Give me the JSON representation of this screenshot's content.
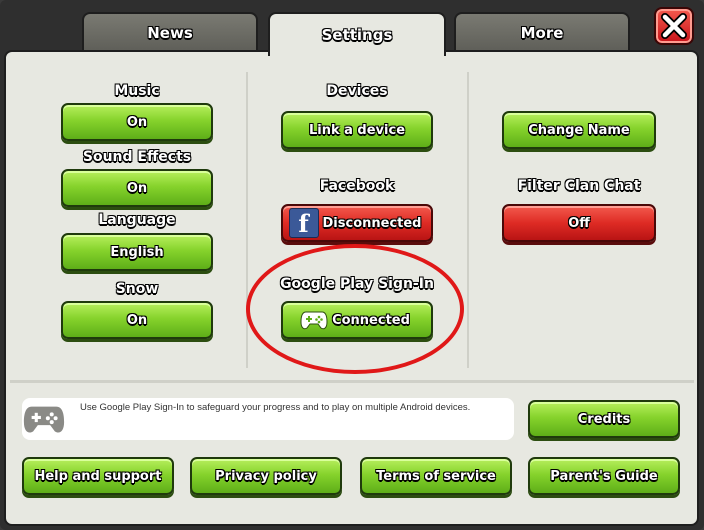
{
  "tabs": [
    {
      "label": "News"
    },
    {
      "label": "Settings"
    },
    {
      "label": "More"
    }
  ],
  "close_label": "X",
  "col1": {
    "music_label": "Music",
    "music_value": "On",
    "sound_label": "Sound Effects",
    "sound_value": "On",
    "language_label": "Language",
    "language_value": "English",
    "snow_label": "Snow",
    "snow_value": "On"
  },
  "col2": {
    "devices_label": "Devices",
    "link_device_button": "Link a device",
    "facebook_label": "Facebook",
    "facebook_button": "Disconnected",
    "gplay_label": "Google Play Sign-In",
    "gplay_button": "Connected"
  },
  "col3": {
    "change_name_button": "Change Name",
    "filter_label": "Filter Clan Chat",
    "filter_value": "Off"
  },
  "info_text": "Use Google Play Sign-In to safeguard your progress and to play on multiple Android devices.",
  "credits_button": "Credits",
  "footer": {
    "help": "Help and support",
    "privacy": "Privacy policy",
    "terms": "Terms of service",
    "parents": "Parent's Guide"
  },
  "colors": {
    "green_button": "#86d32c",
    "red_button": "#de2b24",
    "panel": "#e7e8e1",
    "highlight": "#e01818"
  }
}
